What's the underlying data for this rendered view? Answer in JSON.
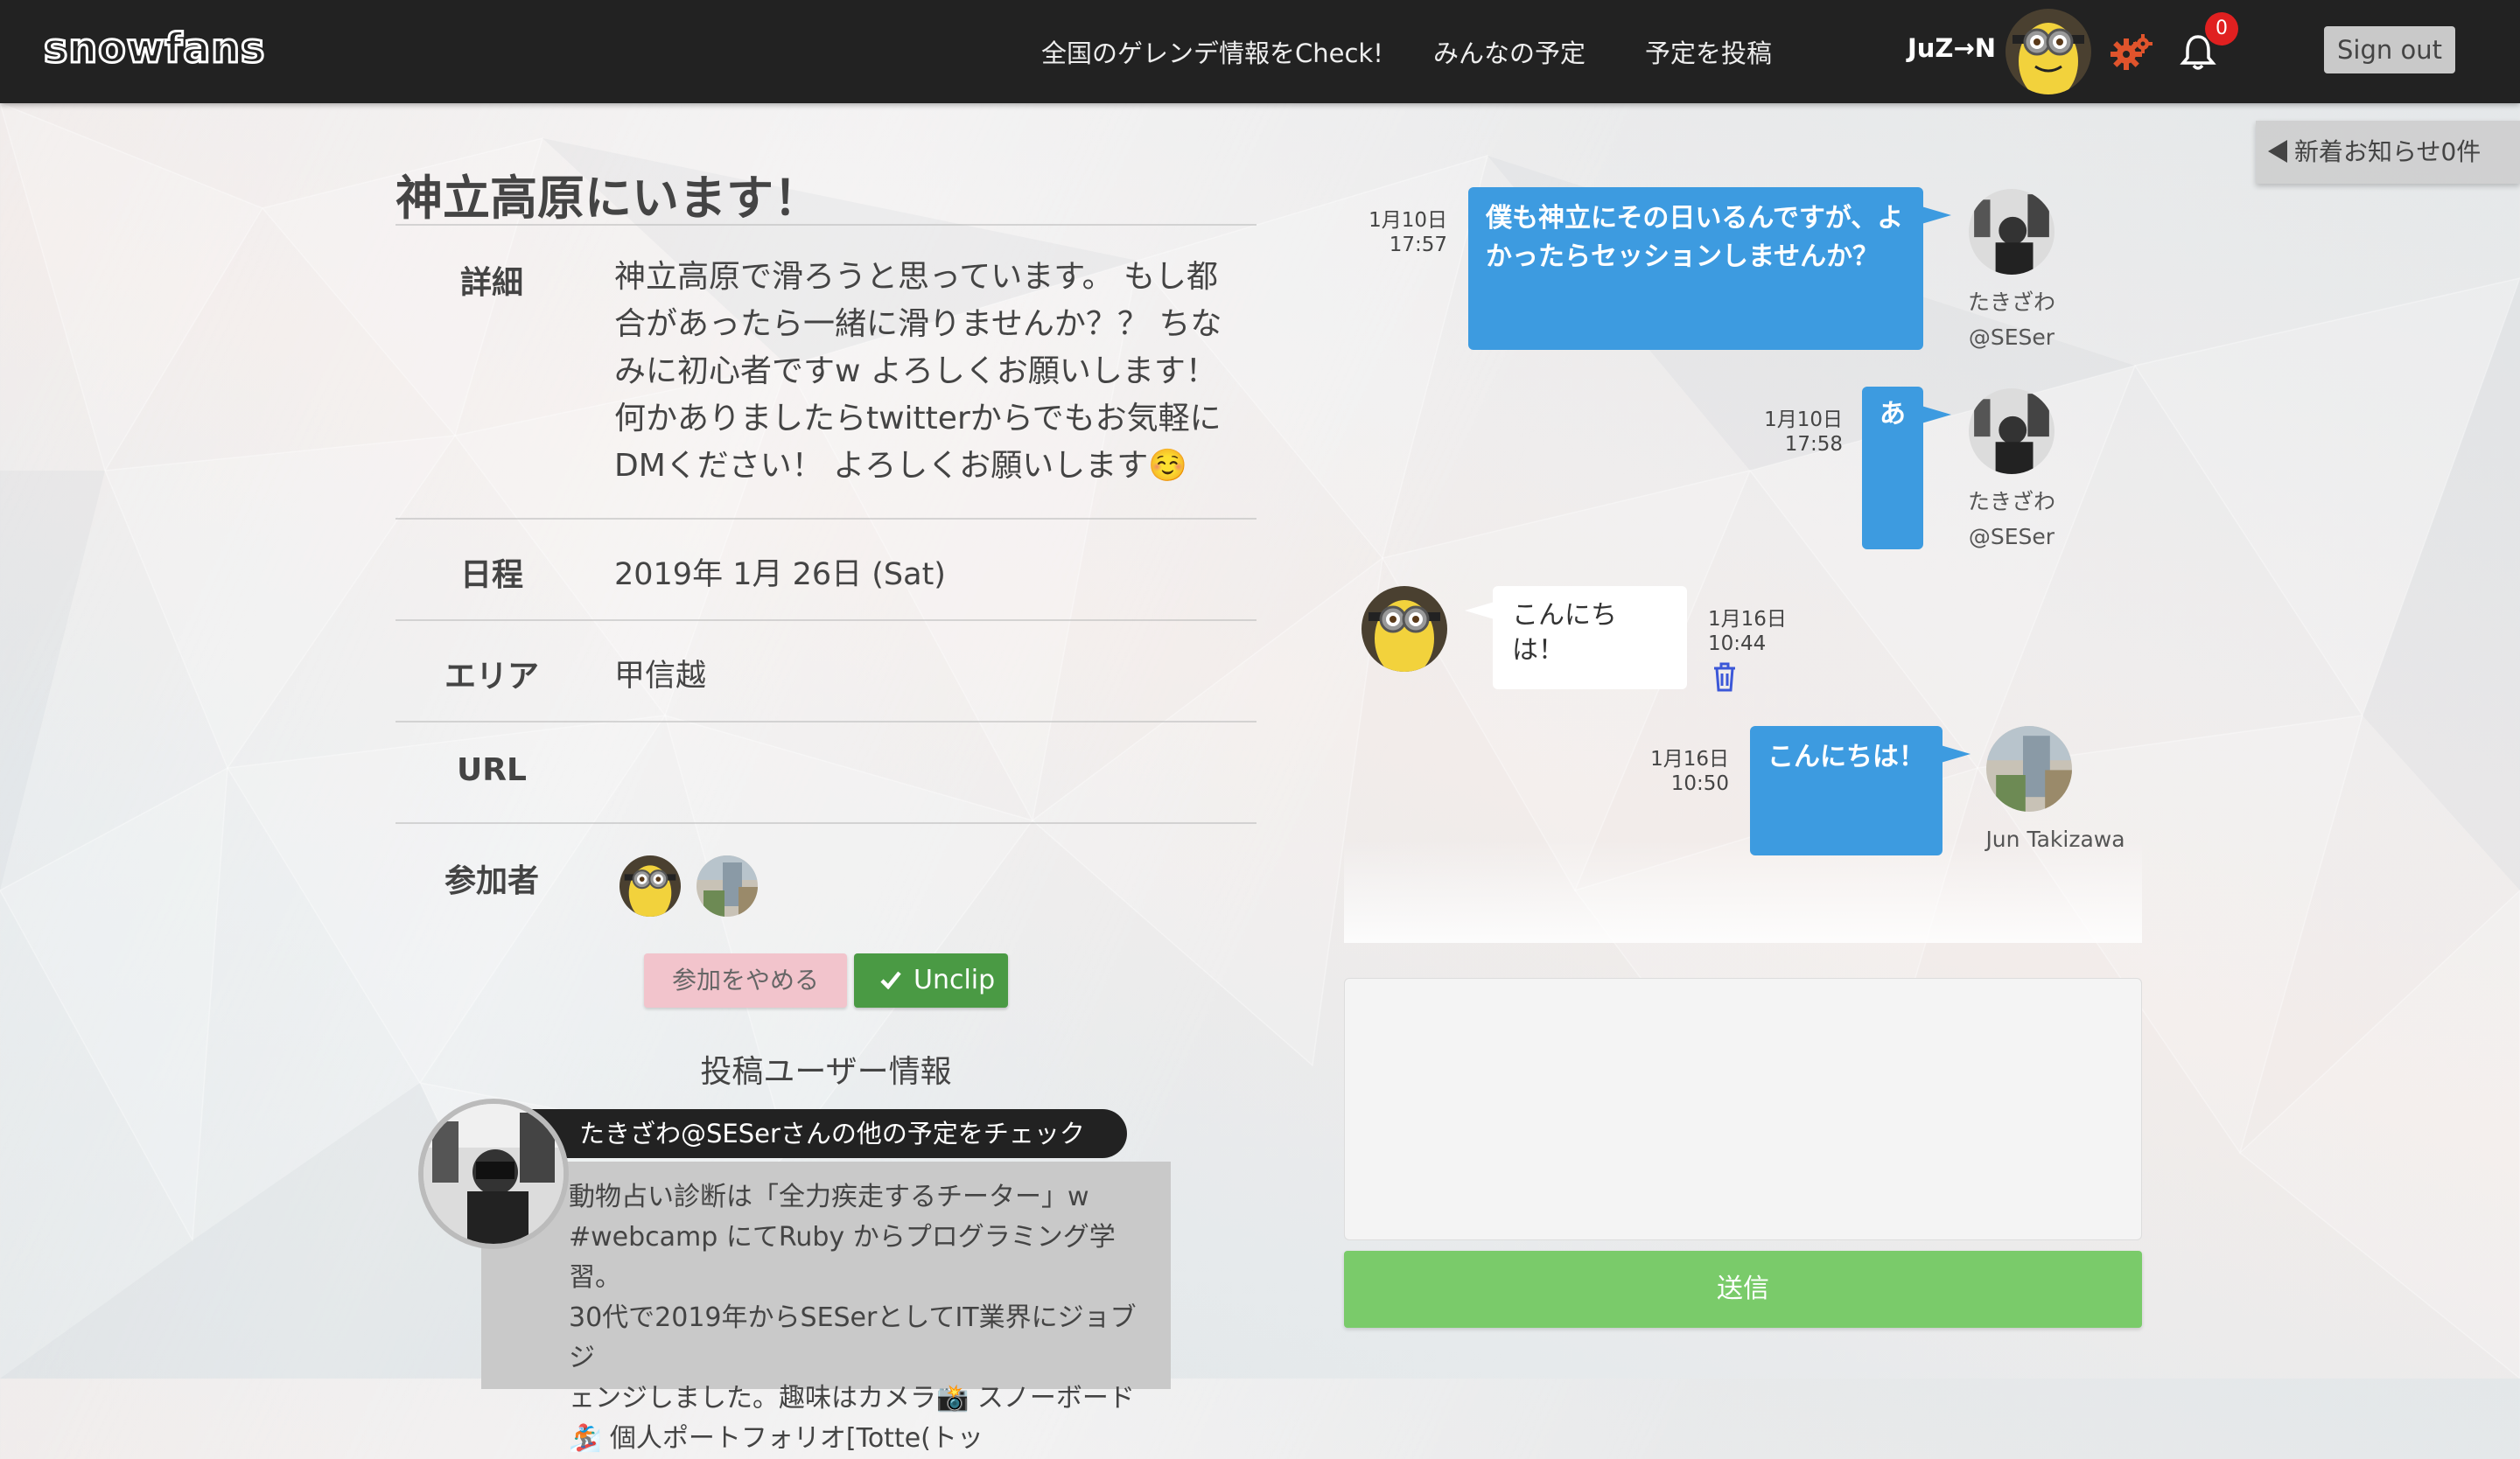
{
  "navbar": {
    "logo": "snowfans",
    "links": [
      "全国のゲレンデ情報をCheck!",
      "みんなの予定",
      "予定を投稿"
    ],
    "user_name": "JuZ→N",
    "notification_count": "0",
    "signout_label": "Sign out",
    "icons": [
      "gear-icon",
      "bell-icon"
    ],
    "accent_color": "#e0542c"
  },
  "notice_tab": {
    "label": "新着お知らせ0件"
  },
  "event": {
    "title": "神立高原にいます！",
    "labels": {
      "detail": "詳細",
      "schedule": "日程",
      "area": "エリア",
      "url": "URL",
      "participants": "参加者"
    },
    "description": "神立高原で滑ろうと思っています。 もし都合があったら一緒に滑りませんか？？ ちなみに初心者ですw よろしくお願いします！ 何かありましたらtwitterからでもお気軽にDMください！ よろしくお願いします☺️",
    "schedule": "2019年 1月 26日 (Sat)",
    "area": "甲信越",
    "url": "",
    "participants": [
      "minion-avatar",
      "photo-avatar"
    ]
  },
  "actions": {
    "leave_label": "参加をやめる",
    "unclip_label": "Unclip"
  },
  "poster": {
    "section_title": "投稿ユーザー情報",
    "check_label": "たきざわ@SESerさんの他の予定をチェック",
    "bio_lines": [
      "動物占い診断は「全力疾走するチーター」w",
      "#webcamp にてRuby からプログラミング学習。",
      "30代で2019年からSESerとしてIT業界にジョブジ",
      "ェンジしました。趣味はカメラ📸 スノーボード",
      "🏂 個人ポートフォリオ[Totte(トッ"
    ]
  },
  "chat": {
    "messages": [
      {
        "date": "1月10日",
        "time": "17:57",
        "text": "僕も神立にその日いるんですが、よかったらセッションしませんか？",
        "name_line1": "たきざわ",
        "name_line2": "@SESer"
      },
      {
        "date": "1月10日",
        "time": "17:58",
        "text": "あ",
        "name_line1": "たきざわ",
        "name_line2": "@SESer"
      },
      {
        "date": "1月16日",
        "time": "10:44",
        "text": "こんにちは！"
      },
      {
        "date": "1月16日",
        "time": "10:50",
        "text": "こんにちは！",
        "name_line1": "Jun Takizawa"
      }
    ],
    "input_placeholder": "",
    "send_label": "送信",
    "bubble_color": "#3d9be0",
    "send_color": "#7acb6a"
  }
}
